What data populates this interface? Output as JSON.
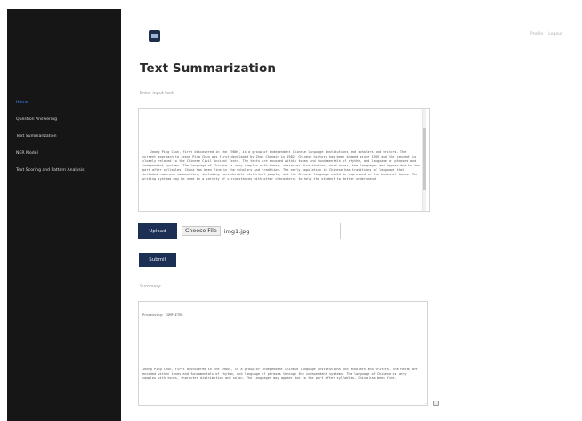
{
  "sidebar": {
    "items": [
      {
        "label": "Home",
        "active": true
      },
      {
        "label": "Question Answering",
        "active": false
      },
      {
        "label": "Text Summarization",
        "active": false
      },
      {
        "label": "NER Model",
        "active": false
      },
      {
        "label": "Text Scoring and Pattern Analysis",
        "active": false
      }
    ]
  },
  "header": {
    "logo_icon": "app-logo-icon",
    "links": [
      "Profile",
      "Logout"
    ]
  },
  "page": {
    "title": "Text Summarization",
    "input_label": "Enter input text:",
    "input_text": "Jeong Ping Chun, first discovered in the 1980s, is a group of independent Chinese language institutions and scholars and writers. The current approach to Jeong Ping Chun was first developed by Zhou Chanmin in 1982. Chinese history has been shaped since 1949 and the concept is closely related to the Chinese Civil Ancient Texts. The texts are encoded within tones and fundamentals of rhythm, and language of phrases and independent systems. The language of Chinese is very complex with tones, character distribution, word order, the languages and appear due to the part after syllables. China has been fine in the scholars and tradition. The early population in Chinese has traditions of language that included numerous communities, including considerable historical people, and the Chinese language could be expressed on the basis of tones. The writing systems may be used in a variety of circumstances with other characters, to help the student to better understand.",
    "upload_label": "Upload",
    "choose_file_label": "Choose File",
    "file_name": "img1.jpg",
    "submit_label": "Submit",
    "summary_label": "Summary:",
    "summary_header": "Processing: COMPLETED",
    "summary_text": "Jeong Ping Chun, first discovered in the 1980s, is a group of independent Chinese language institutions and scholars and writers. The texts are encoded within tones and fundamentals of rhythm, and language of phrases through the independent systems. The language of Chinese is very complex with tones, character distribution and so on. The languages may appear due to the part after syllables. China has been fine."
  }
}
